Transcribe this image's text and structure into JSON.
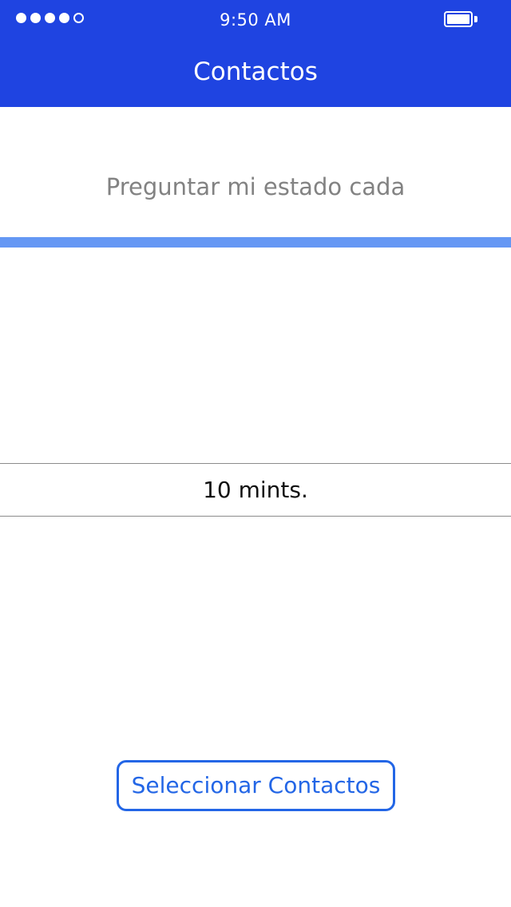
{
  "status_bar": {
    "signal_icon": "signal-strength-icon",
    "signal_filled": 4,
    "signal_total": 5,
    "time": "9:50 AM",
    "battery_icon": "battery-full-icon"
  },
  "header": {
    "title": "Contactos",
    "background_color": "#1f44e1"
  },
  "main": {
    "prompt": "Preguntar mi estado cada",
    "accent_color": "#6497f4",
    "picker": {
      "selected_value": "10 mints."
    },
    "select_contacts_label": "Seleccionar Contactos",
    "button_color": "#2366e6"
  }
}
